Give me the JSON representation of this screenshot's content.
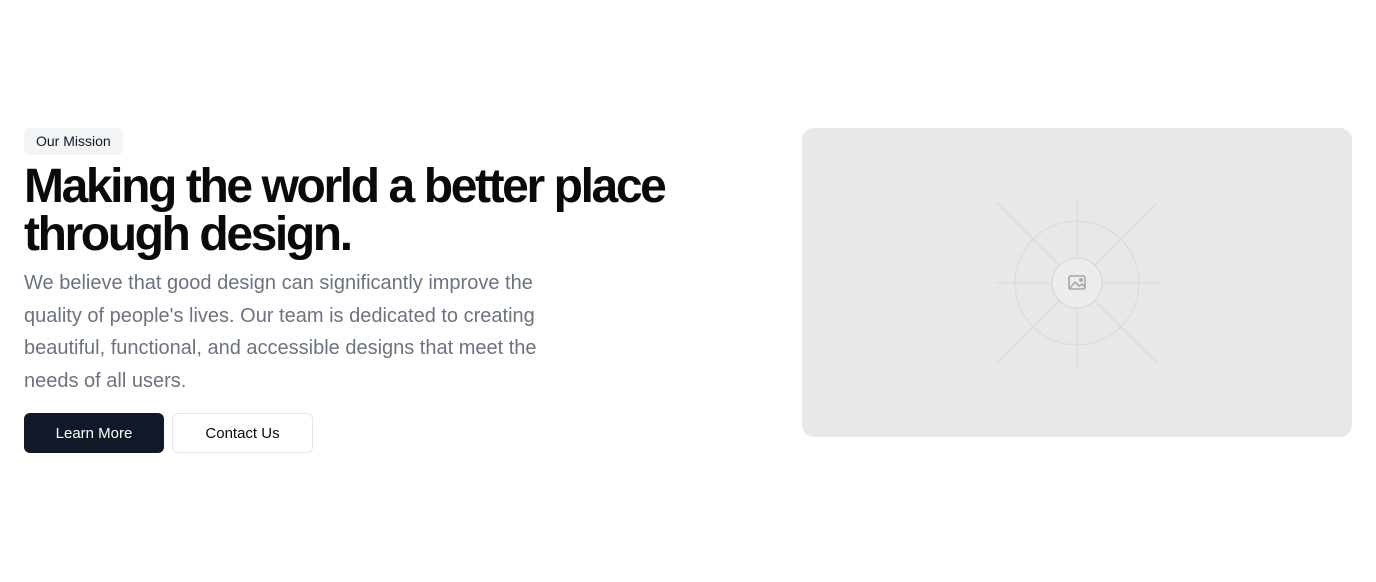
{
  "hero": {
    "badge": "Our Mission",
    "headline_line1": "Making the world a better place",
    "headline_line2": "through design.",
    "description": "We believe that good design can significantly improve the quality of people's lives. Our team is dedicated to creating beautiful, functional, and accessible designs that meet the needs of all users.",
    "primary_button": "Learn More",
    "secondary_button": "Contact Us"
  },
  "media": {
    "icon": "image-placeholder-icon"
  },
  "colors": {
    "primary_button_bg": "#111827",
    "badge_bg": "#f3f4f6",
    "placeholder_bg": "#e8e8e8",
    "description_text": "#6b7280"
  }
}
